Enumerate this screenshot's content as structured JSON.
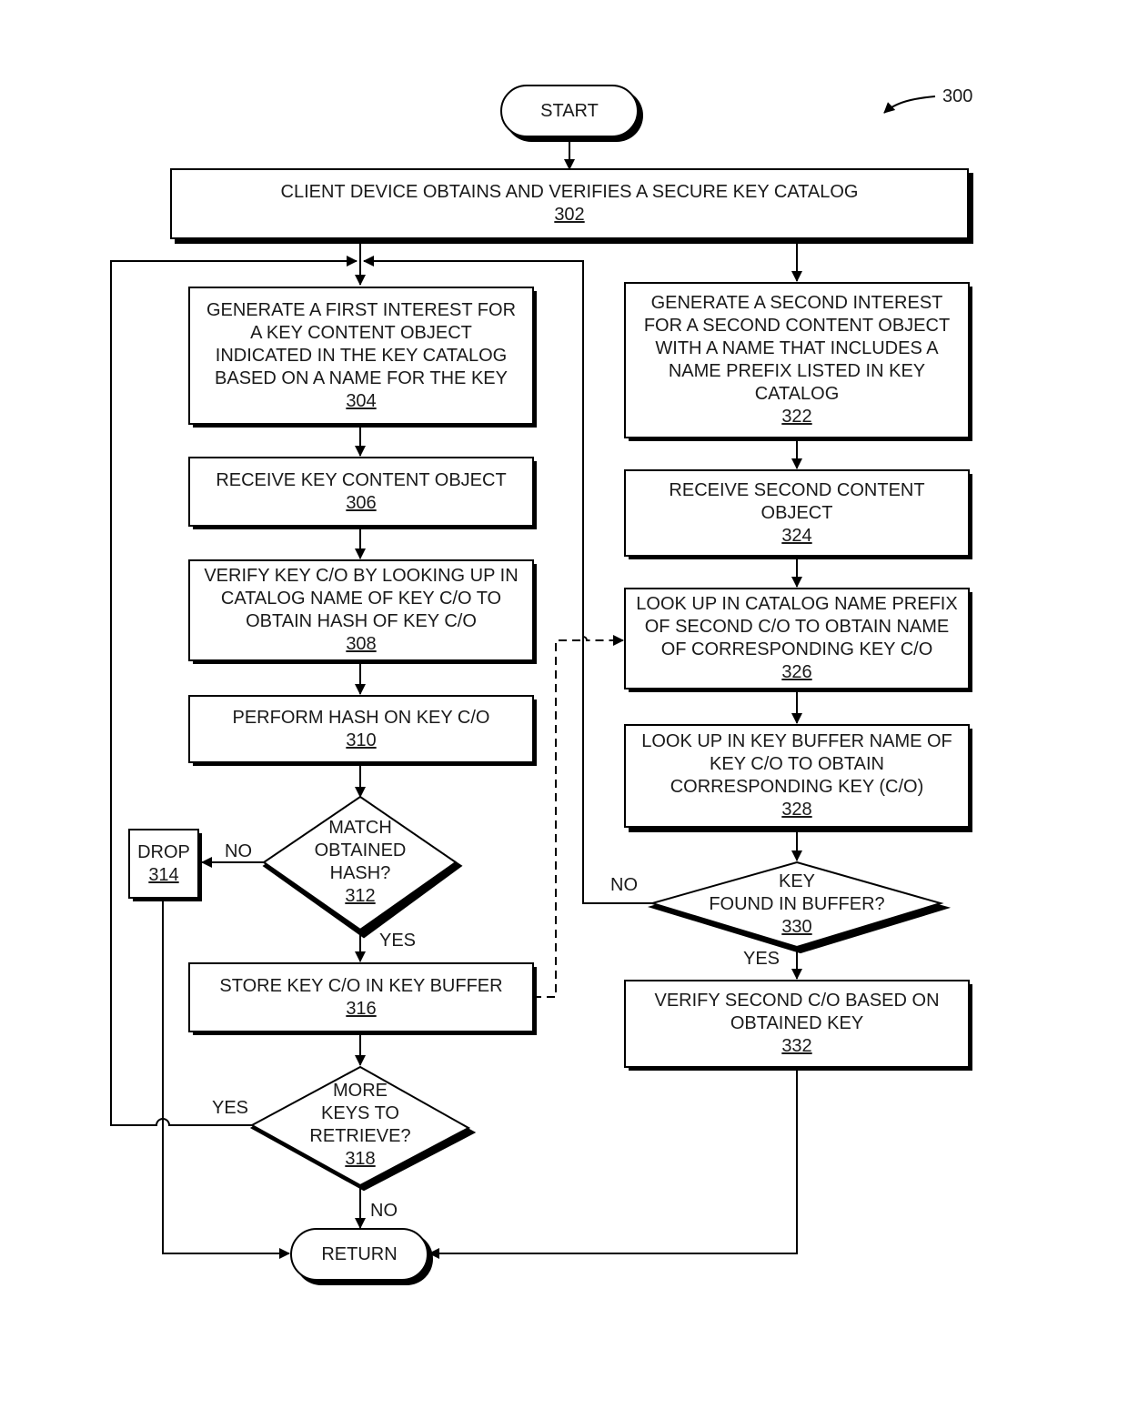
{
  "figure_ref": "300",
  "terminals": {
    "start": "START",
    "return": "RETURN"
  },
  "steps": {
    "s302": {
      "text": "CLIENT DEVICE OBTAINS AND VERIFIES A SECURE KEY CATALOG",
      "ref": "302"
    },
    "s304": {
      "lines": [
        "GENERATE A FIRST INTEREST FOR",
        "A KEY CONTENT OBJECT",
        "INDICATED IN THE KEY CATALOG",
        "BASED ON A NAME FOR THE KEY"
      ],
      "ref": "304"
    },
    "s306": {
      "text": "RECEIVE KEY CONTENT OBJECT",
      "ref": "306"
    },
    "s308": {
      "lines": [
        "VERIFY KEY C/O BY LOOKING UP IN",
        "CATALOG NAME OF KEY C/O TO",
        "OBTAIN HASH OF KEY C/O"
      ],
      "ref": "308"
    },
    "s310": {
      "text": "PERFORM HASH ON KEY C/O",
      "ref": "310"
    },
    "s312": {
      "lines": [
        "MATCH",
        "OBTAINED",
        "HASH?"
      ],
      "ref": "312"
    },
    "s314": {
      "text": "DROP",
      "ref": "314"
    },
    "s316": {
      "text": "STORE KEY C/O IN KEY BUFFER",
      "ref": "316"
    },
    "s318": {
      "lines": [
        "MORE",
        "KEYS TO",
        "RETRIEVE?"
      ],
      "ref": "318"
    },
    "s322": {
      "lines": [
        "GENERATE A SECOND INTEREST",
        "FOR A SECOND CONTENT OBJECT",
        "WITH A NAME THAT INCLUDES A",
        "NAME PREFIX LISTED IN KEY",
        "CATALOG"
      ],
      "ref": "322"
    },
    "s324": {
      "lines": [
        "RECEIVE SECOND CONTENT",
        "OBJECT"
      ],
      "ref": "324"
    },
    "s326": {
      "lines": [
        "LOOK UP IN CATALOG NAME PREFIX",
        "OF SECOND C/O TO OBTAIN NAME",
        "OF CORRESPONDING KEY C/O"
      ],
      "ref": "326"
    },
    "s328": {
      "lines": [
        "LOOK UP IN KEY BUFFER NAME OF",
        "KEY C/O TO OBTAIN",
        "CORRESPONDING KEY (C/O)"
      ],
      "ref": "328"
    },
    "s330": {
      "lines": [
        "KEY",
        "FOUND IN BUFFER?"
      ],
      "ref": "330"
    },
    "s332": {
      "lines": [
        "VERIFY SECOND C/O BASED ON",
        "OBTAINED KEY"
      ],
      "ref": "332"
    }
  },
  "edge_labels": {
    "no_312": "NO",
    "yes_312": "YES",
    "yes_318": "YES",
    "no_318": "NO",
    "no_330": "NO",
    "yes_330": "YES"
  }
}
